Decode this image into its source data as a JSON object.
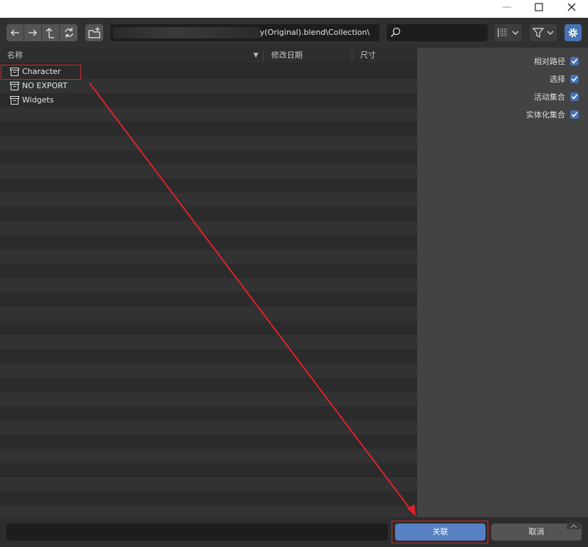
{
  "window": {
    "minimize_glyph": "—",
    "maximize_glyph": "☐",
    "close_glyph": "✕"
  },
  "toolbar": {
    "back_icon": "←",
    "forward_icon": "→",
    "parent_icon": "⮤",
    "refresh_icon": "⟳",
    "path_value": "y(Original).blend\\Collection\\",
    "search_value": ""
  },
  "file_list": {
    "columns": [
      "名称",
      "修改日期",
      "尺寸"
    ],
    "sort_indicator": "▼",
    "items": [
      {
        "label": "Character",
        "icon": "collection-icon"
      },
      {
        "label": "NO EXPORT",
        "icon": "collection-icon"
      },
      {
        "label": "Widgets",
        "icon": "collection-icon"
      }
    ]
  },
  "options": [
    {
      "label": "相对路径",
      "checked": true
    },
    {
      "label": "选择",
      "checked": true
    },
    {
      "label": "活动集合",
      "checked": true
    },
    {
      "label": "实体化集合",
      "checked": true
    }
  ],
  "bottom": {
    "filename_value": "",
    "link_label": "关联",
    "cancel_label": "取消"
  },
  "colors": {
    "accent": "#4772b3",
    "primary_button": "#5680c2",
    "annotation_red": "#e0212a"
  }
}
